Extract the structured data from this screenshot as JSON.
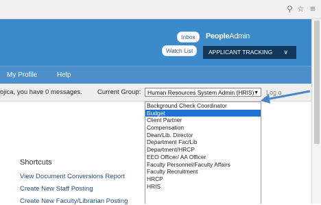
{
  "browser": {
    "zoom_icon": "zoom-icon",
    "star_icon": "star-icon",
    "menu_icon": "menu-icon"
  },
  "header": {
    "inbox_label": "Inbox",
    "watchlist_label": "Watch List",
    "brand_bold": "People",
    "brand_light": "Admin",
    "module_label": "APPLICANT TRACKING",
    "module_chevron": "∨"
  },
  "nav": {
    "items": [
      "My Profile",
      "Help"
    ]
  },
  "messages": {
    "text": "ojica, you have 0 messages.",
    "group_label": "Current Group:"
  },
  "group_select": {
    "selected": "Human Resources System Admin (HRIS)",
    "options": [
      "Background Check Coordinator",
      "Budget",
      "Client Partner",
      "Compensation",
      "Dean/Lib. Director",
      "Department Fac/Lib",
      "Department/HRCP",
      "EEO Officer/ AA Officer",
      "Faculty Personnel/Faculty Affairs",
      "Faculty Recruitment",
      "HRCP",
      "HRIS"
    ],
    "highlighted_index": 1,
    "truncated_right_text": "Log o"
  },
  "shortcuts": {
    "title": "Shortcuts",
    "links": [
      "View Document Conversions Report",
      "Create New Staff Posting",
      "Create New Faculty/Librarian Posting"
    ]
  },
  "colors": {
    "header_blue": "#3c8ac9",
    "nav_blue": "#4d8fca",
    "module_navy": "#12385c",
    "highlight": "#1e73d2",
    "annotation_arrow": "#4a86c6"
  }
}
